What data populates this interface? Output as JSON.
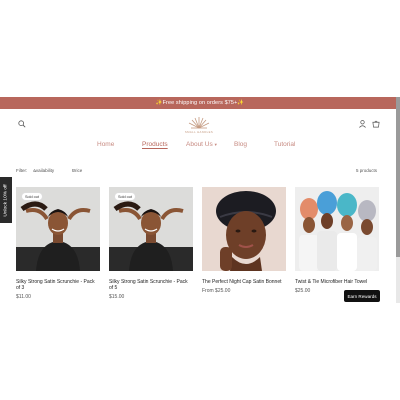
{
  "announcement": "✨Free shipping on orders $75+✨",
  "logo": {
    "name": "SMALL HANDLES"
  },
  "nav": {
    "items": [
      {
        "label": "Home",
        "active": false
      },
      {
        "label": "Products",
        "active": true
      },
      {
        "label": "About Us",
        "active": false,
        "dropdown": true
      },
      {
        "label": "Blog",
        "active": false
      },
      {
        "label": "Tutorial",
        "active": false
      }
    ]
  },
  "filters": {
    "label": "Filter:",
    "availability": "Availability",
    "price": "Price",
    "count": "5 products"
  },
  "side_tab": "Unlock 10% off",
  "products": [
    {
      "title": "Silky Strong Satin Scrunchie - Pack of 3",
      "price": "$11.00",
      "badge": "Sold out"
    },
    {
      "title": "Silky Strong Satin Scrunchie - Pack of 5",
      "price": "$15.00",
      "badge": "Sold out"
    },
    {
      "title": "The Perfect Night Cap Satin Bonnet",
      "price": "From $25.00",
      "badge": ""
    },
    {
      "title": "Twist & Tie Microfiber Hair Towel",
      "price": "$25.00",
      "badge": ""
    }
  ],
  "rewards_button": "Earn Rewards",
  "colors": {
    "accent": "#b8675c",
    "nav": "#c78b82"
  },
  "icons": [
    "search-icon",
    "account-icon",
    "cart-icon",
    "chevron-down-icon"
  ]
}
